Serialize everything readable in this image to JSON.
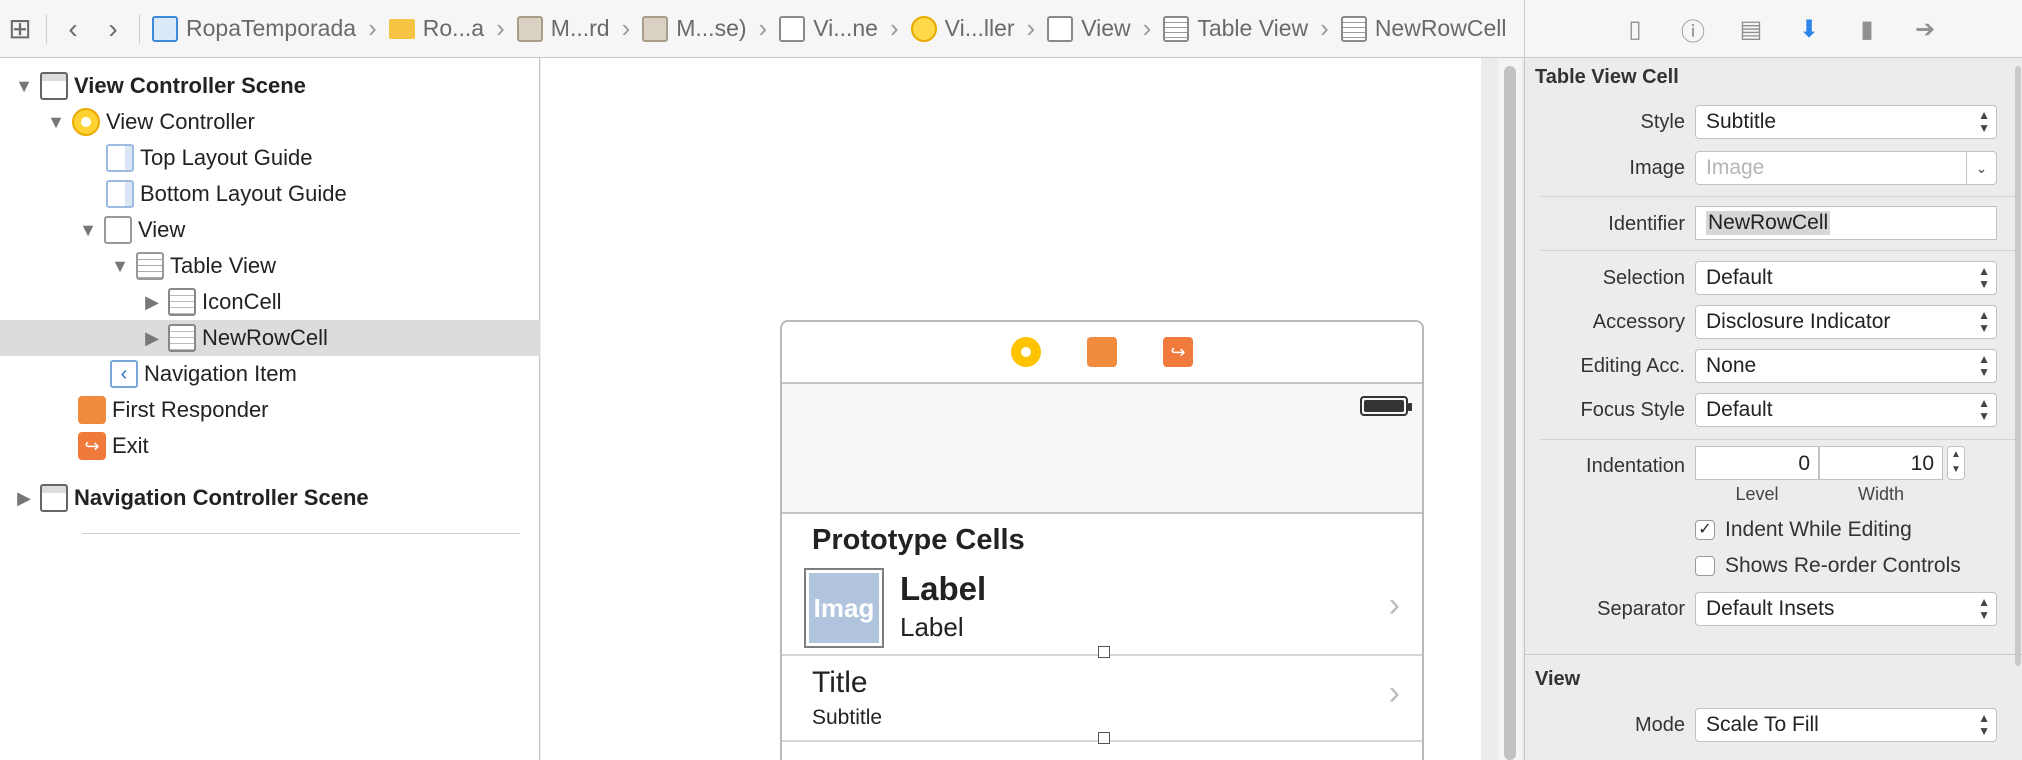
{
  "breadcrumbs": [
    "RopaTemporada",
    "Ro...a",
    "M...rd",
    "M...se)",
    "Vi...ne",
    "Vi...ller",
    "View",
    "Table View",
    "NewRowCell"
  ],
  "outline": {
    "vc_scene": "View Controller Scene",
    "view_controller": "View Controller",
    "top_layout_guide": "Top Layout Guide",
    "bottom_layout_guide": "Bottom Layout Guide",
    "view": "View",
    "table_view": "Table View",
    "icon_cell": "IconCell",
    "new_row_cell": "NewRowCell",
    "navigation_item": "Navigation Item",
    "first_responder": "First Responder",
    "exit": "Exit",
    "nav_scene": "Navigation Controller Scene"
  },
  "canvas": {
    "section_header": "Prototype Cells",
    "cell1": {
      "image": "Imag",
      "title": "Label",
      "subtitle": "Label"
    },
    "cell2": {
      "title": "Title",
      "subtitle": "Subtitle"
    }
  },
  "inspector": {
    "section_title": "Table View Cell",
    "style_label": "Style",
    "style_value": "Subtitle",
    "image_label": "Image",
    "image_placeholder": "Image",
    "identifier_label": "Identifier",
    "identifier_value": "NewRowCell",
    "selection_label": "Selection",
    "selection_value": "Default",
    "accessory_label": "Accessory",
    "accessory_value": "Disclosure Indicator",
    "editing_acc_label": "Editing Acc.",
    "editing_acc_value": "None",
    "focus_style_label": "Focus Style",
    "focus_style_value": "Default",
    "indentation_label": "Indentation",
    "level_value": "0",
    "level_label": "Level",
    "width_value": "10",
    "width_label": "Width",
    "indent_while_editing": "Indent While Editing",
    "indent_checked": true,
    "shows_reorder": "Shows Re-order Controls",
    "reorder_checked": false,
    "separator_label": "Separator",
    "separator_value": "Default Insets",
    "view_section": "View",
    "mode_label": "Mode",
    "mode_value": "Scale To Fill"
  },
  "colors": {
    "accent": "#2e86e8",
    "selected_row": "#dcdcdc",
    "image_placeholder": "#b0c4de"
  }
}
